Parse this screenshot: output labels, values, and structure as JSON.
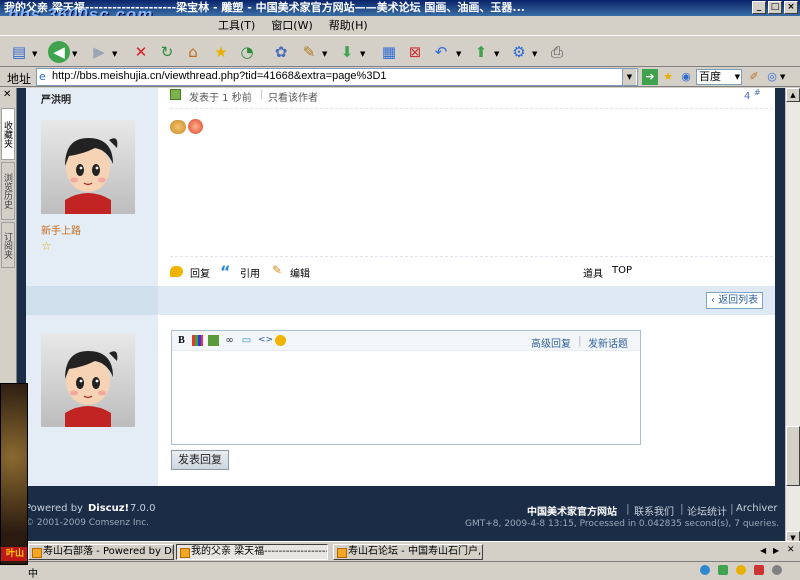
{
  "window": {
    "title": "我的父亲 梁天福--------------------梁宝林 - 雕塑 - 中国美术家官方网站——美术论坛 国画、油画、玉器...",
    "watermark": "bbs.3600sc.com",
    "controls": [
      "_",
      "□",
      "×"
    ]
  },
  "menu": {
    "items": [
      "工具(T)",
      "窗口(W)",
      "帮助(H)"
    ]
  },
  "toolbar": {
    "icons": [
      "new-page-icon",
      "back-icon",
      "forward-icon",
      "stop-icon",
      "refresh-icon",
      "home-icon",
      "favorites-icon",
      "history-icon",
      "settings-icon",
      "tools-icon",
      "download-icon",
      "view-icon",
      "close-tab-icon",
      "undo-icon",
      "upload-icon",
      "network-icon",
      "print-icon"
    ]
  },
  "address": {
    "label": "地址",
    "url": "http://bbs.meishujia.cn/viewthread.php?tid=41668&extra=page%3D1",
    "search_engine": "百度"
  },
  "sidebar": {
    "tabs": [
      "收藏夹",
      "浏览历史",
      "订阅夹"
    ]
  },
  "post": {
    "author": "严洪明",
    "posted_label": "发表于 1 秒前",
    "only_author": "只看该作者",
    "floor": "4",
    "floor_suffix": "#",
    "rank": "新手上路",
    "actions": {
      "reply": "回复",
      "quote": "引用",
      "edit": "编辑"
    },
    "tools": "道具",
    "top": "TOP"
  },
  "back_to_list": "返回列表",
  "editor": {
    "toolbar_icons": [
      "bold-icon",
      "color-icon",
      "image-icon",
      "link-icon",
      "quote-icon",
      "code-icon",
      "smiley-icon"
    ],
    "advanced_reply": "高级回复",
    "new_topic": "发新话题",
    "submit": "发表回复"
  },
  "footer": {
    "powered": "Powered by",
    "brand": "Discuz!",
    "version": "7.0.0",
    "copyright": "© 2001-2009 Comsenz Inc.",
    "site": "中国美术家官方网站",
    "contact": "联系我们",
    "stats": "论坛统计",
    "archiver": "Archiver",
    "processed": "GMT+8, 2009-4-8 13:15, Processed in 0.042835 second(s), 7 queries."
  },
  "taskbar": {
    "tabs": [
      {
        "label": "寿山石部落 - Powered by Disc..."
      },
      {
        "label": "我的父亲 梁天福-----------------------"
      },
      {
        "label": "寿山石论坛 - 中国寿山石门户,..."
      }
    ]
  },
  "popup": {
    "label": "叶山"
  },
  "status": {
    "text": "中"
  }
}
